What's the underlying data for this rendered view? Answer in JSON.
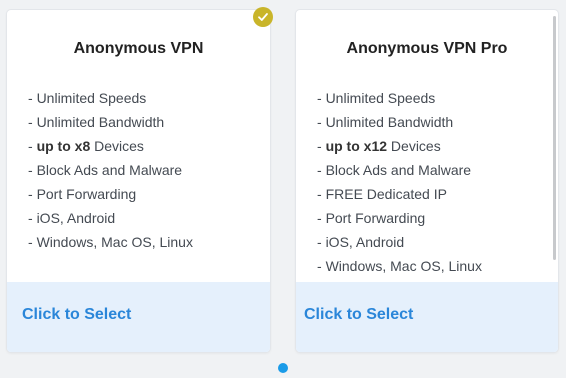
{
  "plans": [
    {
      "title": "Anonymous VPN",
      "selected": true,
      "select_label": "Click to Select",
      "features": [
        {
          "prefix": "- ",
          "bold": "",
          "text": "Unlimited Speeds"
        },
        {
          "prefix": "- ",
          "bold": "",
          "text": "Unlimited Bandwidth"
        },
        {
          "prefix": "- ",
          "bold": "up to x8",
          "text": " Devices"
        },
        {
          "prefix": "- ",
          "bold": "",
          "text": "Block Ads and Malware"
        },
        {
          "prefix": "- ",
          "bold": "",
          "text": "Port Forwarding"
        },
        {
          "prefix": "- ",
          "bold": "",
          "text": "iOS, Android"
        },
        {
          "prefix": "- ",
          "bold": "",
          "text": "Windows, Mac OS, Linux"
        }
      ]
    },
    {
      "title": "Anonymous VPN Pro",
      "selected": false,
      "select_label": "Click to Select",
      "features": [
        {
          "prefix": "- ",
          "bold": "",
          "text": "Unlimited Speeds"
        },
        {
          "prefix": "- ",
          "bold": "",
          "text": "Unlimited Bandwidth"
        },
        {
          "prefix": "- ",
          "bold": "up to x12",
          "text": " Devices"
        },
        {
          "prefix": "- ",
          "bold": "",
          "text": "Block Ads and Malware"
        },
        {
          "prefix": "- ",
          "bold": "",
          "text": "FREE Dedicated IP"
        },
        {
          "prefix": "- ",
          "bold": "",
          "text": "Port Forwarding"
        },
        {
          "prefix": "- ",
          "bold": "",
          "text": "iOS, Android"
        },
        {
          "prefix": "- ",
          "bold": "",
          "text": "Windows, Mac OS, Linux"
        }
      ]
    }
  ],
  "selected_badge_icon": "checkmark-icon",
  "pagination": {
    "icon": "pagination-dot-icon",
    "current_page": 1
  },
  "colors": {
    "accent": "#2a86d9",
    "select_bg": "#e5f0fc",
    "badge": "#c9b52a",
    "dot": "#1a9be8"
  }
}
